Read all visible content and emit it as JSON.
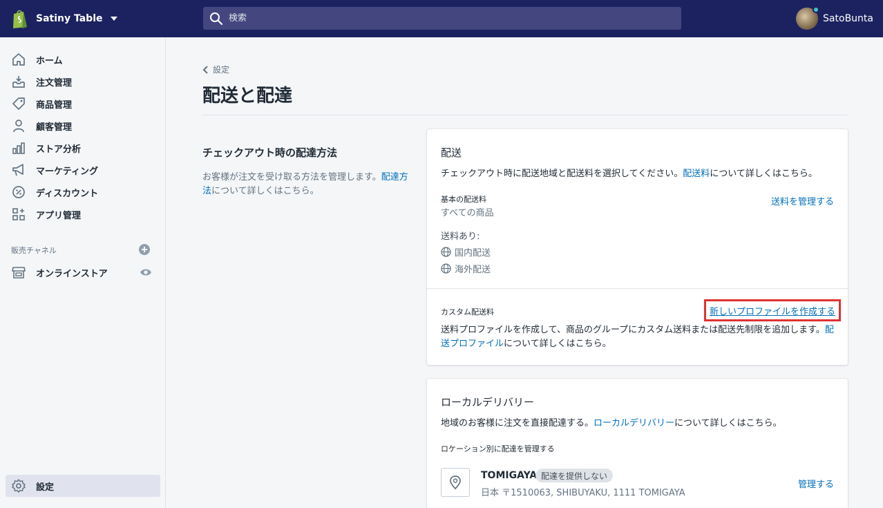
{
  "topbar": {
    "store_name": "Satiny Table",
    "search_placeholder": "検索",
    "user_name": "SatoBunta"
  },
  "sidebar": {
    "items": [
      {
        "label": "ホーム",
        "icon": "home-icon"
      },
      {
        "label": "注文管理",
        "icon": "orders-icon"
      },
      {
        "label": "商品管理",
        "icon": "tag-icon"
      },
      {
        "label": "顧客管理",
        "icon": "person-icon"
      },
      {
        "label": "ストア分析",
        "icon": "chart-icon"
      },
      {
        "label": "マーケティング",
        "icon": "megaphone-icon"
      },
      {
        "label": "ディスカウント",
        "icon": "discount-icon"
      },
      {
        "label": "アプリ管理",
        "icon": "apps-icon"
      }
    ],
    "channels_title": "販売チャネル",
    "online_store": "オンラインストア",
    "settings": "設定"
  },
  "page": {
    "back_label": "設定",
    "title": "配送と配達"
  },
  "annotation": {
    "title": "チェックアウト時の配達方法",
    "desc_text": "お客様が注文を受け取る方法を管理します。",
    "desc_link": "配達方法",
    "desc_suffix": "について詳しくはこちら。"
  },
  "shipping_card": {
    "title": "配送",
    "desc_text": "チェックアウト時に配送地域と配送料を選択してください。",
    "desc_link": "配送料",
    "desc_suffix": "について詳しくはこちら。",
    "general_title": "基本の配送料",
    "general_sub": "すべての商品",
    "manage_rates": "送料を管理する",
    "rates_label": "送料あり:",
    "rate_domestic": "国内配送",
    "rate_international": "海外配送",
    "custom_title": "カスタム配送料",
    "create_profile": "新しいプロファイルを作成する",
    "custom_desc_text": "送料プロファイルを作成して、商品のグループにカスタム送料または配送先制限を追加します。",
    "custom_desc_link": "配送プロファイル",
    "custom_desc_suffix": "について詳しくはこちら。"
  },
  "local_card": {
    "title": "ローカルデリバリー",
    "desc_text": "地域のお客様に注文を直接配達する。",
    "desc_link": "ローカルデリバリー",
    "desc_suffix": "について詳しくはこちら。",
    "by_location": "ロケーション別に配達を管理する",
    "location_name": "TOMIGAYA",
    "badge": "配達を提供しない",
    "address": "日本 〒1510063, SHIBUYAKU, 1111 TOMIGAYA",
    "manage": "管理する"
  },
  "colors": {
    "topbar": "#1c2260",
    "link": "#006fbb",
    "highlight": "#e03131"
  }
}
